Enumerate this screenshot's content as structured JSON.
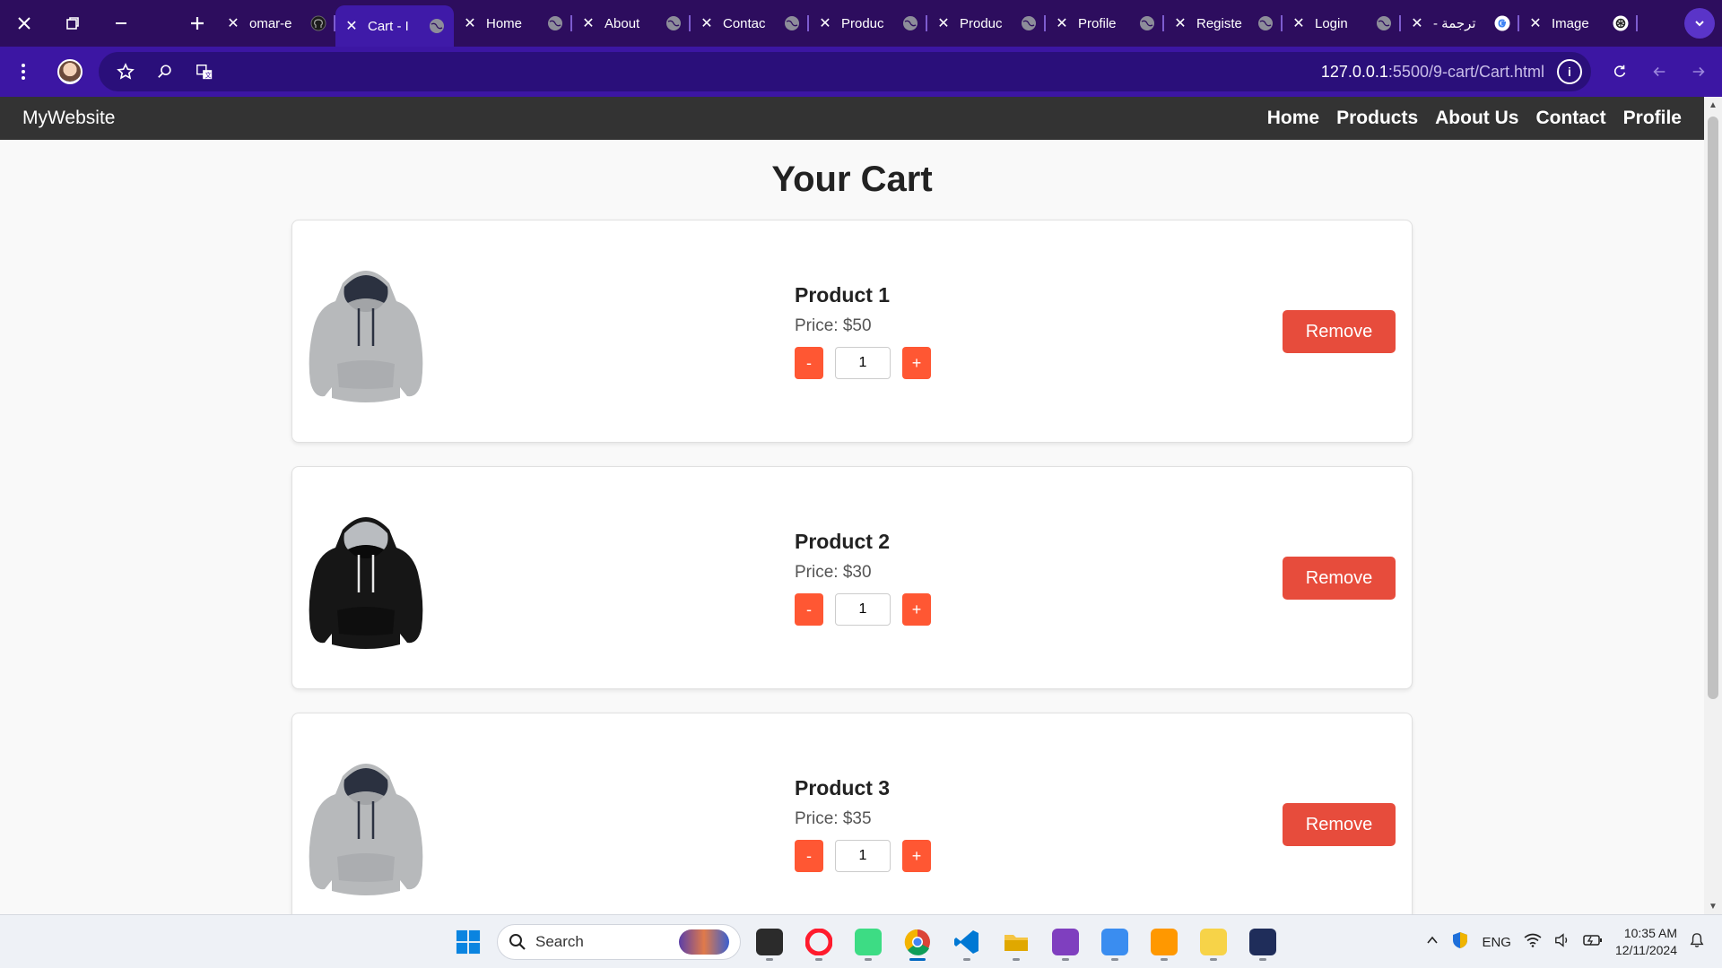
{
  "tabs": [
    {
      "title": "omar-e",
      "icon": "github-icon",
      "active": false
    },
    {
      "title": "Cart - I",
      "icon": "globe-icon",
      "active": true
    },
    {
      "title": "Home",
      "icon": "globe-icon",
      "active": false
    },
    {
      "title": "About",
      "icon": "globe-icon",
      "active": false
    },
    {
      "title": "Contac",
      "icon": "globe-icon",
      "active": false
    },
    {
      "title": "Produc",
      "icon": "globe-icon",
      "active": false
    },
    {
      "title": "Produc",
      "icon": "globe-icon",
      "active": false
    },
    {
      "title": "Profile",
      "icon": "globe-icon",
      "active": false
    },
    {
      "title": "Registe",
      "icon": "globe-icon",
      "active": false
    },
    {
      "title": "Login",
      "icon": "globe-icon",
      "active": false
    },
    {
      "title": "- ترجمة",
      "icon": "google-icon",
      "active": false
    },
    {
      "title": "Image",
      "icon": "openai-icon",
      "active": false
    }
  ],
  "address_bar": {
    "host": "127.0.0.1",
    "path": ":5500/9-cart/Cart.html"
  },
  "site": {
    "brand": "MyWebsite",
    "nav": [
      "Home",
      "Products",
      "About Us",
      "Contact",
      "Profile"
    ],
    "page_title": "Your Cart"
  },
  "cart_items": [
    {
      "name": "Product 1",
      "price": "Price: $50",
      "quantity": "1",
      "hoodie_color": "#b7b9bb",
      "remove_label": "Remove"
    },
    {
      "name": "Product 2",
      "price": "Price: $30",
      "quantity": "1",
      "hoodie_color": "#161616",
      "remove_label": "Remove"
    },
    {
      "name": "Product 3",
      "price": "Price: $35",
      "quantity": "1",
      "hoodie_color": "#b7b9bb",
      "remove_label": "Remove"
    }
  ],
  "qty_controls": {
    "minus": "-",
    "plus": "+"
  },
  "colors": {
    "qty_button": "#ff5733",
    "remove_button": "#e74c3c",
    "site_nav": "#333333",
    "browser_tabbar": "#2d0d5e",
    "browser_toolbar": "#3c16a3"
  },
  "taskbar": {
    "search_label": "Search",
    "language": "ENG",
    "time": "10:35 AM",
    "date": "12/11/2024",
    "apps": [
      "file-explorer-dark-icon",
      "opera-icon",
      "android-studio-icon",
      "chrome-icon",
      "vscode-icon",
      "file-explorer-icon",
      "visual-studio-icon",
      "copilot-icon",
      "sublime-icon",
      "sticky-notes-icon",
      "hackerrank-icon"
    ]
  }
}
